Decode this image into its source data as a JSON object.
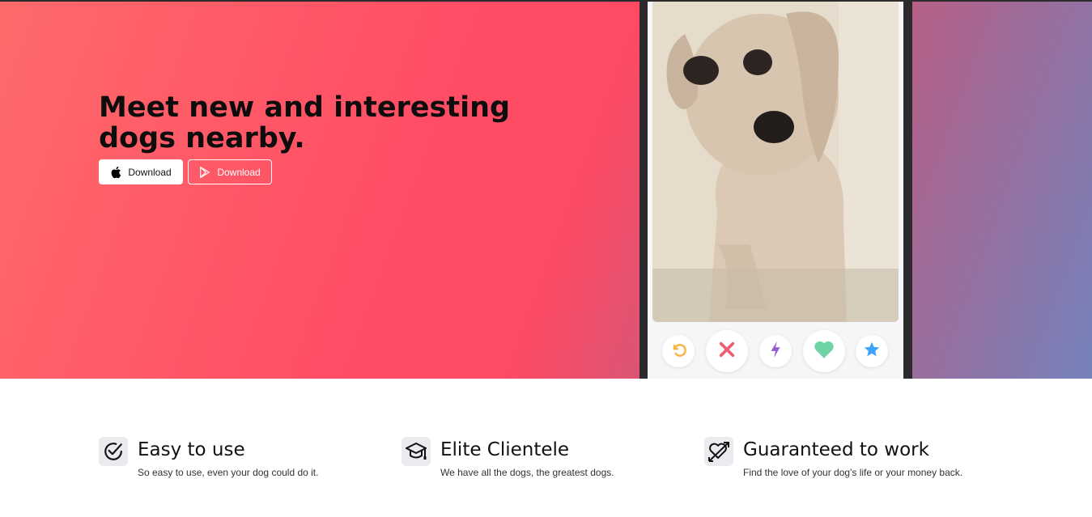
{
  "hero": {
    "headline": "Meet new and interesting dogs nearby.",
    "buttons": {
      "apple_label": "Download",
      "play_label": "Download"
    },
    "gradient_colors": [
      "#fe6a6a",
      "#ff4d65",
      "#7482bb"
    ]
  },
  "phone": {
    "photo_alt": "dog-photo",
    "actions": [
      {
        "name": "rewind",
        "icon": "rewind-icon",
        "color": "#f5b748"
      },
      {
        "name": "nope",
        "icon": "x-icon",
        "color": "#ec5e6f"
      },
      {
        "name": "boost",
        "icon": "lightning-icon",
        "color": "#915dd1"
      },
      {
        "name": "like",
        "icon": "heart-icon",
        "color": "#6fd3a4"
      },
      {
        "name": "super-like",
        "icon": "star-icon",
        "color": "#3ca4ff"
      }
    ]
  },
  "features": [
    {
      "title": "Easy to use",
      "description": "So easy to use, even your dog could do it.",
      "icon": "check-circle-icon"
    },
    {
      "title": "Elite Clientele",
      "description": "We have all the dogs, the greatest dogs.",
      "icon": "graduation-cap-icon"
    },
    {
      "title": "Guaranteed to work",
      "description": "Find the love of your dog's life or your money back.",
      "icon": "heart-arrow-icon"
    }
  ]
}
